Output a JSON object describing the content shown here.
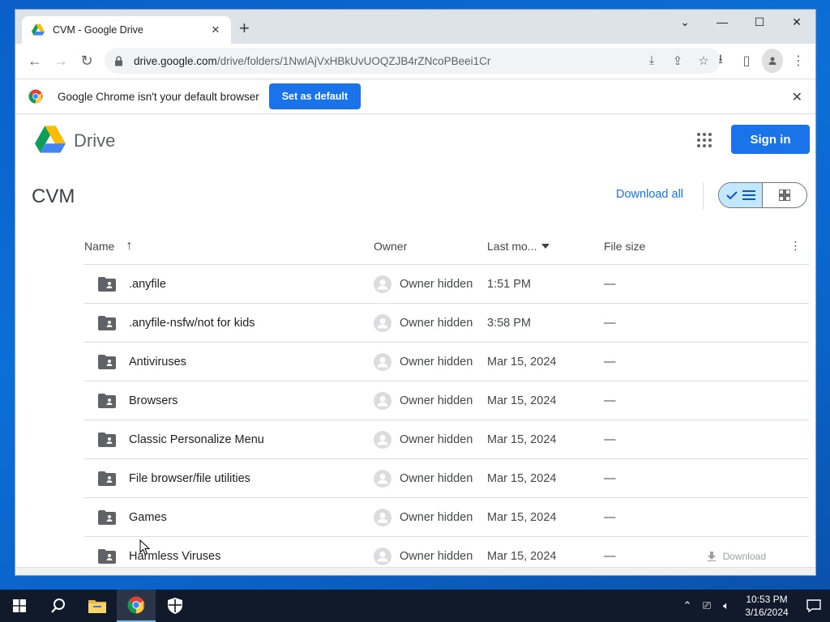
{
  "browser": {
    "tab_title": "CVM - Google Drive",
    "url_host": "drive.google.com",
    "url_path": "/drive/folders/1NwlAjVxHBkUvUOQZJB4rZNcoPBeei1Cr",
    "icons": [
      "back-icon",
      "forward-icon",
      "reload-icon",
      "lock-icon",
      "install-icon",
      "share-icon",
      "bookmark-star-icon",
      "downloads-icon",
      "side-panel-icon",
      "profile-icon",
      "menu-kebab-icon"
    ]
  },
  "infobar": {
    "message": "Google Chrome isn't your default browser",
    "button": "Set as default"
  },
  "drive": {
    "logo_text": "Drive",
    "sign_in": "Sign in",
    "folder_title": "CVM",
    "download_all": "Download all",
    "columns": {
      "name": "Name",
      "owner": "Owner",
      "last_modified": "Last mo...",
      "file_size": "File size"
    },
    "rows": [
      {
        "name": ".anyfile",
        "owner": "Owner hidden",
        "date": "1:51 PM",
        "size": "—"
      },
      {
        "name": ".anyfile-nsfw/not for kids",
        "owner": "Owner hidden",
        "date": "3:58 PM",
        "size": "—"
      },
      {
        "name": "Antiviruses",
        "owner": "Owner hidden",
        "date": "Mar 15, 2024",
        "size": "—"
      },
      {
        "name": "Browsers",
        "owner": "Owner hidden",
        "date": "Mar 15, 2024",
        "size": "—"
      },
      {
        "name": "Classic Personalize Menu",
        "owner": "Owner hidden",
        "date": "Mar 15, 2024",
        "size": "—"
      },
      {
        "name": "File browser/file utilities",
        "owner": "Owner hidden",
        "date": "Mar 15, 2024",
        "size": "—"
      },
      {
        "name": "Games",
        "owner": "Owner hidden",
        "date": "Mar 15, 2024",
        "size": "—"
      },
      {
        "name": "Harmless Viruses",
        "owner": "Owner hidden",
        "date": "Mar 15, 2024",
        "size": "—",
        "download": "Download"
      }
    ],
    "colors": {
      "accent": "#1a73e8",
      "selected_view": "#c2e7ff"
    }
  },
  "taskbar": {
    "time": "10:53 PM",
    "date": "3/16/2024"
  }
}
